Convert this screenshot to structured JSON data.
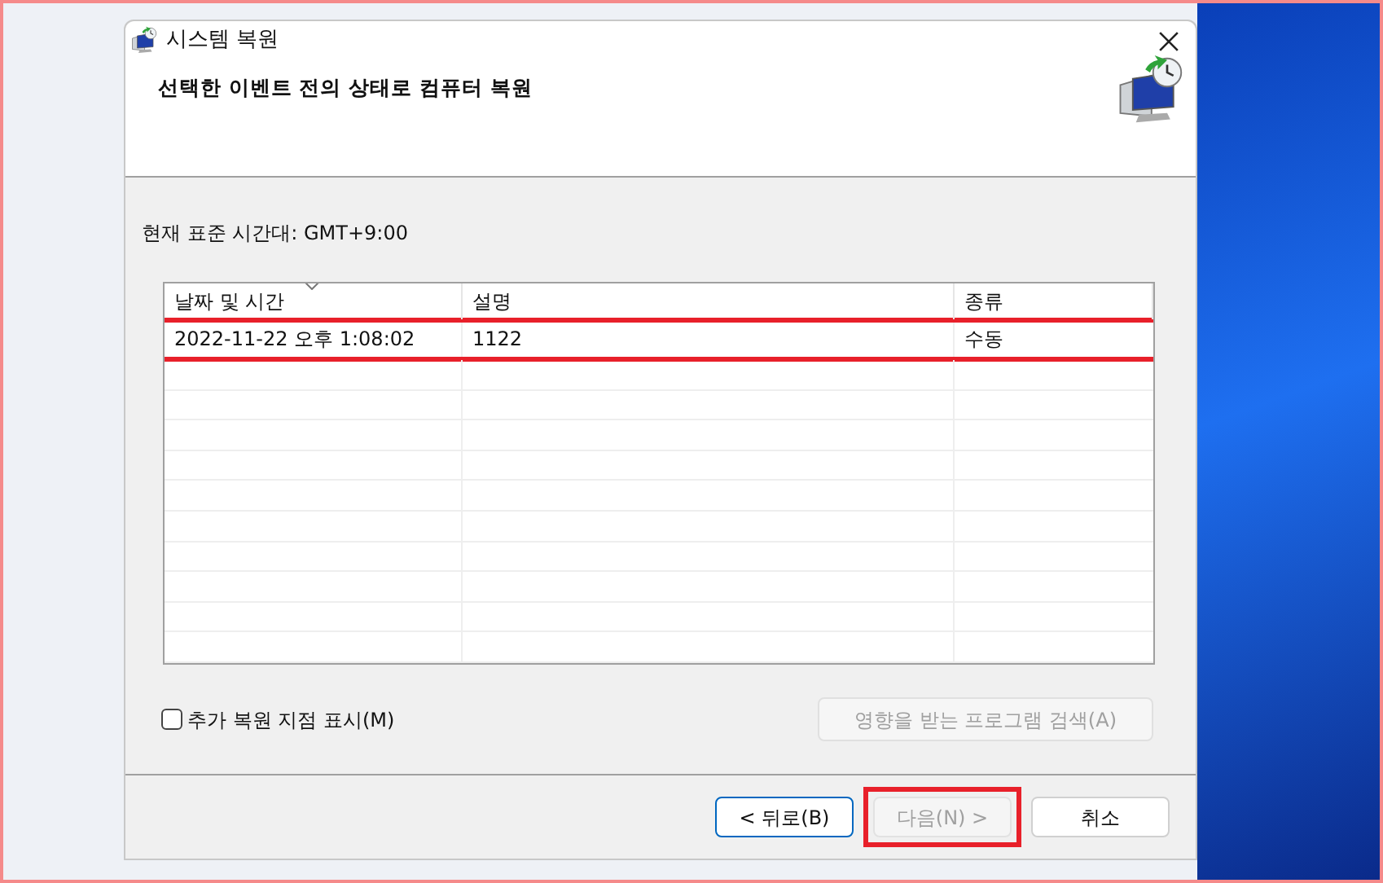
{
  "window": {
    "title": "시스템 복원"
  },
  "heading": "선택한 이벤트 전의 상태로 컴퓨터 복원",
  "timezone": "현재 표준 시간대: GMT+9:00",
  "table": {
    "columns": [
      {
        "label": "날짜 및 시간",
        "sorted": true
      },
      {
        "label": "설명",
        "sorted": false
      },
      {
        "label": "종류",
        "sorted": false
      }
    ],
    "rows": [
      {
        "cells": [
          "2022-11-22 오후 1:08:02",
          "1122",
          "수동"
        ],
        "selected": false,
        "annotated": true
      }
    ]
  },
  "show_more": {
    "label": "추가 복원 지점 표시(M)",
    "checked": false
  },
  "scan_button": {
    "label": "영향을 받는 프로그램 검색(A)",
    "disabled": true
  },
  "buttons": [
    {
      "label": "< 뒤로(B)",
      "disabled": false,
      "default": true,
      "annotated": false
    },
    {
      "label": "다음(N) >",
      "disabled": true,
      "default": false,
      "annotated": true
    },
    {
      "label": "취소",
      "disabled": false,
      "default": false,
      "annotated": false
    }
  ]
}
